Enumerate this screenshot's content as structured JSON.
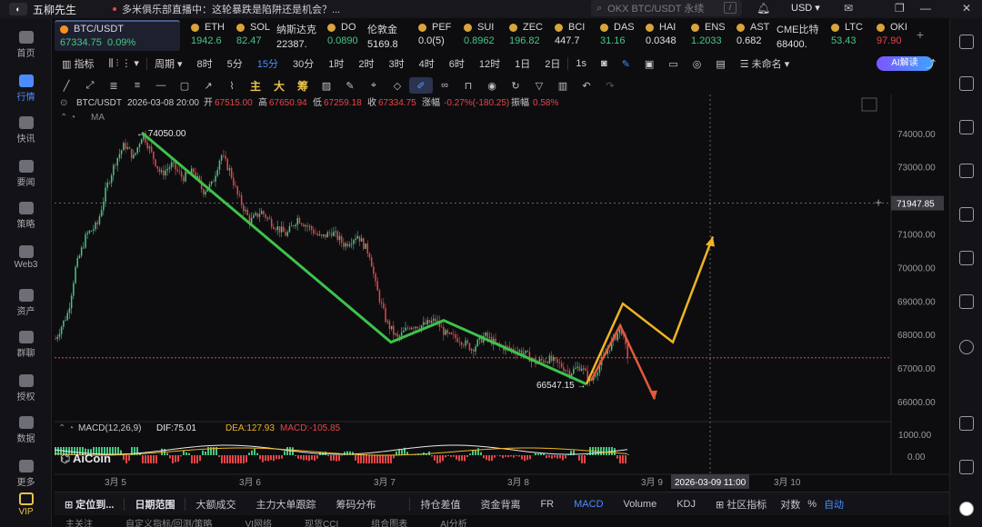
{
  "app": {
    "name": "五柳先生"
  },
  "broadcast": "多米俱乐部直播中：这轮暴跌是陷阱还是机会？...",
  "search": {
    "placeholder": "OKX BTC/USDT 永续",
    "shortcut": "/"
  },
  "currency": "USD",
  "left_nav": [
    {
      "label": "首页",
      "active": false
    },
    {
      "label": "行情",
      "active": true
    },
    {
      "label": "快讯",
      "active": false
    },
    {
      "label": "要闻",
      "active": false
    },
    {
      "label": "策略",
      "active": false
    },
    {
      "label": "Web3",
      "active": false
    },
    {
      "label": "资产",
      "active": false
    },
    {
      "label": "群聊",
      "active": false
    },
    {
      "label": "授权",
      "active": false
    },
    {
      "label": "数据",
      "active": false
    },
    {
      "label": "更多",
      "active": false
    },
    {
      "label": "VIP",
      "active": false
    }
  ],
  "tickers": [
    {
      "symbol": "BTC/USDT",
      "price": "67334.75",
      "change": "0.09%",
      "dir": "up"
    },
    {
      "symbol": "ETH",
      "price": "1942.6",
      "dir": "up"
    },
    {
      "symbol": "SOL",
      "price": "82.47",
      "dir": "up"
    },
    {
      "symbol": "纳斯达克",
      "price": "22387.",
      "dir": "wh"
    },
    {
      "symbol": "DO",
      "price": "0.0890",
      "dir": "up"
    },
    {
      "symbol": "伦敦金",
      "price": "5169.8",
      "dir": "wh"
    },
    {
      "symbol": "PEF",
      "price": "0.0(5)",
      "dir": "wh"
    },
    {
      "symbol": "SUI",
      "price": "0.8962",
      "dir": "up"
    },
    {
      "symbol": "ZEC",
      "price": "196.82",
      "dir": "up"
    },
    {
      "symbol": "BCI",
      "price": "447.7",
      "dir": "wh"
    },
    {
      "symbol": "DAS",
      "price": "31.16",
      "dir": "up"
    },
    {
      "symbol": "HAI",
      "price": "0.0348",
      "dir": "wh"
    },
    {
      "symbol": "ENS",
      "price": "1.2033",
      "dir": "up"
    },
    {
      "symbol": "AST",
      "price": "0.682",
      "dir": "wh"
    },
    {
      "symbol": "CME比特",
      "price": "68400.",
      "dir": "wh"
    },
    {
      "symbol": "LTC",
      "price": "53.43",
      "dir": "up"
    },
    {
      "symbol": "OKI",
      "price": "97.90",
      "dir": "down"
    }
  ],
  "toolbar": {
    "indicator": "指标",
    "period": "周期",
    "intervals": [
      "8时",
      "5分",
      "15分",
      "30分",
      "1时",
      "2时",
      "3时",
      "4时",
      "6时",
      "12时",
      "1日",
      "2日",
      "1s"
    ],
    "active_interval": "15分",
    "unnamed": "未命名",
    "ai": "AI解读"
  },
  "draw_tools": {
    "zhu": "主",
    "da": "大",
    "chou": "筹"
  },
  "chart_header": {
    "symbol": "BTC/USDT",
    "datetime": "2026-03-08 20:00",
    "open_label": "开",
    "open": "67515.00",
    "high_label": "高",
    "high": "67650.94",
    "low_label": "低",
    "low": "67259.18",
    "close_label": "收",
    "close": "67334.75",
    "change_label": "涨幅",
    "change": "-0.27%(-180.25)",
    "amp_label": "振幅",
    "amp": "0.58%",
    "ma": "MA"
  },
  "chart_data": {
    "type": "candlestick",
    "symbol": "BTC/USDT",
    "interval": "15分",
    "y_ticks": [
      74000,
      73000,
      72000,
      71000,
      70000,
      69000,
      68000,
      67000,
      66000
    ],
    "y_tick_labels": [
      "74000.00",
      "73000.00",
      "72000.00",
      "71000.00",
      "70000.00",
      "69000.00",
      "68000.00",
      "67000.00",
      "66000.00"
    ],
    "x_tick_labels": [
      "3月 5",
      "3月 6",
      "3月 7",
      "3月 8",
      "3月 9",
      "3月 10"
    ],
    "crosshair_price": "71947.85",
    "crosshair_time": "2026-03-09 11:00",
    "current_price_line": 67334.75,
    "annotations": [
      {
        "label": "74050.00",
        "price": 74050
      },
      {
        "label": "66547.15",
        "price": 66547.15
      }
    ],
    "trend_lines_green": [
      {
        "from": [
          "3月 5",
          74050
        ],
        "to": [
          "3月 7",
          67800
        ]
      },
      {
        "from": [
          "3月 7",
          67800
        ],
        "to": [
          "3月 7",
          68450
        ]
      },
      {
        "from": [
          "3月 7",
          68450
        ],
        "to": [
          "3月 8",
          66550
        ]
      }
    ],
    "projection_yellow": [
      {
        "date": "3月 8",
        "price": 66550
      },
      {
        "date": "3月 8",
        "price": 68950
      },
      {
        "date": "3月 9",
        "price": 67800
      },
      {
        "date": "3月 9",
        "price": 70950
      }
    ],
    "projection_red": [
      {
        "date": "3月 8",
        "price": 66650
      },
      {
        "date": "3月 8",
        "price": 68300
      },
      {
        "date": "3月 9",
        "price": 66100
      }
    ],
    "macd": {
      "label": "MACD(12,26,9)",
      "dif_label": "DIF:",
      "dif": "75.01",
      "dea_label": "DEA:",
      "dea": "127.93",
      "macd_label": "MACD:",
      "macd": "-105.85",
      "y_tick_labels": [
        "1000.00",
        "0.00"
      ]
    },
    "watermark": "AiCoin"
  },
  "colors": {
    "up": "#45c783",
    "down": "#e84545",
    "accent": "#4a8cff",
    "projection": "#f0b323",
    "trend": "#3ec24a"
  },
  "bottom_tabs": {
    "locate": "定位到...",
    "range": "日期范围",
    "items": [
      "大额成交",
      "主力大单跟踪",
      "筹码分布",
      "持仓差值",
      "资金背离",
      "FR",
      "MACD",
      "Volume",
      "KDJ"
    ],
    "active": "MACD",
    "community": "社区指标",
    "log": "对数",
    "pct": "%",
    "auto": "自动"
  },
  "footer": [
    "主关注",
    "自定义指标/回测/策略",
    "VI网络",
    "现货CCI",
    "组合图表",
    "AI分析"
  ]
}
